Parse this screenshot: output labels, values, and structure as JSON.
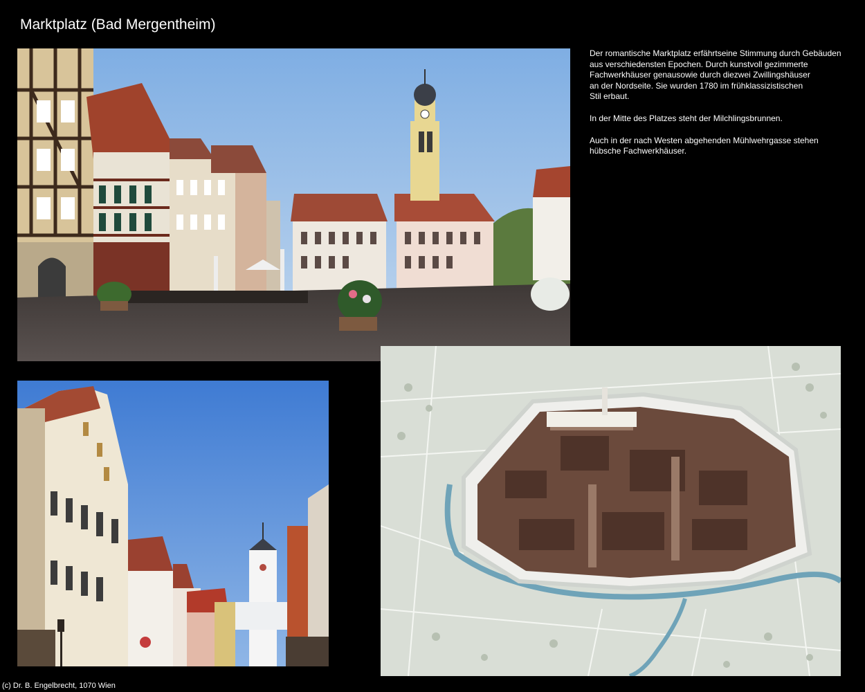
{
  "page": {
    "title": "Marktplatz (Bad Mergentheim)",
    "footer": "(c) Dr. B. Engelbrecht, 1070 Wien"
  },
  "description": {
    "paragraphs": [
      "Der romantische Marktplatz erfährtseine Stimmung durch Gebäuden\naus verschiedensten Epochen. Durch kunstvoll gezimmerte\nFachwerkhäuser genausowie durch diezwei Zwillingshäuser\nan der Nordseite. Sie wurden 1780 im frühklassizistischen\nStil erbaut.",
      "In der Mitte des Platzes steht der Milchlingsbrunnen.",
      "Auch in der nach Westen abgehenden Mühlwehrgasse stehen\nhübsche Fachwerkhäuser."
    ]
  },
  "colors": {
    "background": "#000000",
    "text": "#ffffff",
    "sky": "#8fb6e6",
    "timber": "#5a3b24",
    "roof": "#9c4a33",
    "pavement": "#4a423f",
    "model_ground": "#d9ded6",
    "river": "#6fa3b8"
  },
  "photos": [
    {
      "name": "market-square-photo",
      "subject": "market square with half-timbered houses and church tower"
    },
    {
      "name": "street-photo",
      "subject": "street with gabled houses and white gate tower"
    },
    {
      "name": "town-model-photo",
      "subject": "historic town model surrounded by river and walls"
    }
  ]
}
